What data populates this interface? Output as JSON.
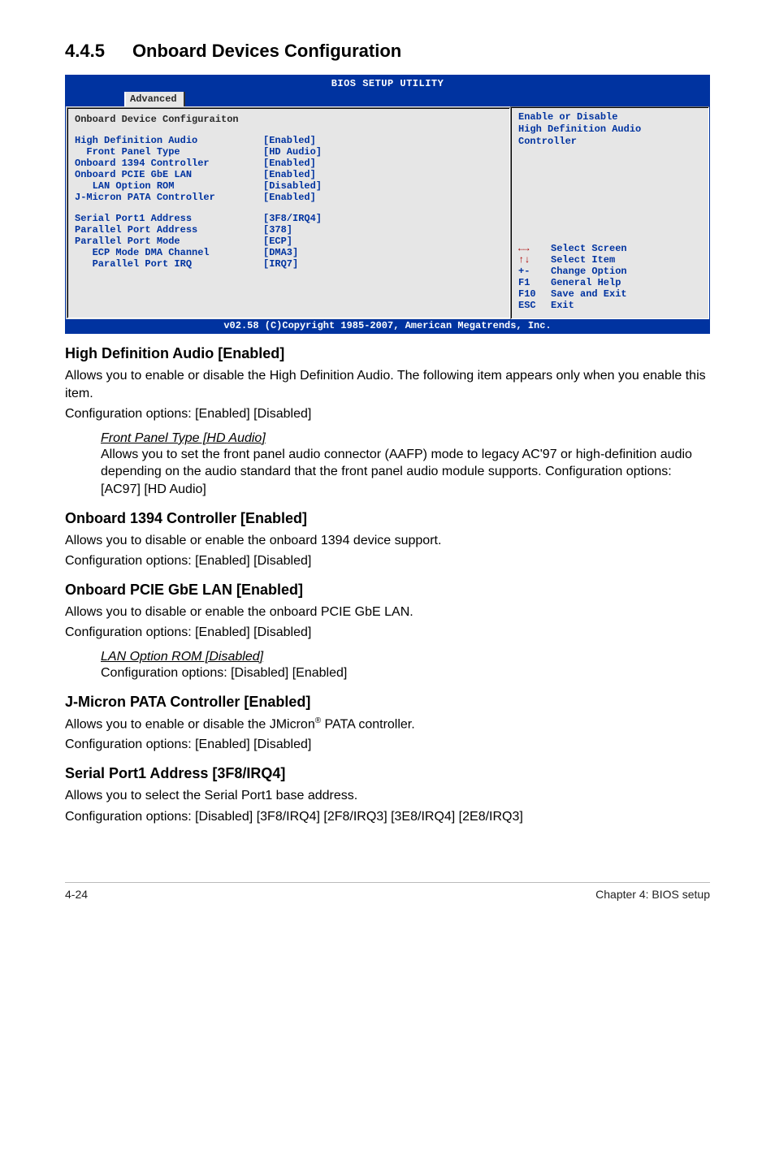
{
  "section": {
    "number": "4.4.5",
    "title": "Onboard Devices Configuration"
  },
  "bios": {
    "utility_title": "BIOS SETUP UTILITY",
    "tab": "Advanced",
    "panel_title": "Onboard Device Configuraiton",
    "rows": [
      {
        "label": "High Definition Audio",
        "value": "[Enabled]"
      },
      {
        "label": "  Front Panel Type",
        "value": "[HD Audio]"
      },
      {
        "label": "Onboard 1394 Controller",
        "value": "[Enabled]"
      },
      {
        "label": "Onboard PCIE GbE LAN",
        "value": "[Enabled]"
      },
      {
        "label": "   LAN Option ROM",
        "value": "[Disabled]"
      },
      {
        "label": "J-Micron PATA Controller",
        "value": "[Enabled]"
      }
    ],
    "rows2": [
      {
        "label": "Serial Port1 Address",
        "value": "[3F8/IRQ4]"
      },
      {
        "label": "Parallel Port Address",
        "value": "[378]"
      },
      {
        "label": "Parallel Port Mode",
        "value": "[ECP]"
      },
      {
        "label": "   ECP Mode DMA Channel",
        "value": "[DMA3]"
      },
      {
        "label": "   Parallel Port IRQ",
        "value": "[IRQ7]"
      }
    ],
    "help": {
      "l1": "Enable or Disable",
      "l2": "High Definition Audio",
      "l3": "Controller"
    },
    "nav": [
      {
        "key_html": "←→",
        "class": "arrow-lr",
        "text": "Select Screen"
      },
      {
        "key_html": "↑↓",
        "class": "arrow-ud",
        "text": "Select Item"
      },
      {
        "key_html": "+-",
        "class": "",
        "text": "Change Option"
      },
      {
        "key_html": "F1",
        "class": "",
        "text": "General Help"
      },
      {
        "key_html": "F10",
        "class": "",
        "text": "Save and Exit"
      },
      {
        "key_html": "ESC",
        "class": "",
        "text": "Exit"
      }
    ],
    "footer": "v02.58 (C)Copyright 1985-2007, American Megatrends, Inc."
  },
  "text": {
    "h_hd": "High Definition Audio [Enabled]",
    "p_hd1": "Allows you to enable or disable the High Definition Audio. The following item appears only when you enable this item.",
    "p_hd2": "Configuration options: [Enabled] [Disabled]",
    "fp_head": "Front Panel Type [HD Audio]",
    "fp_body": "Allows you to set the front panel audio connector (AAFP) mode to legacy AC'97 or high-definition audio depending on the audio standard that the front panel audio module supports. Configuration options: [AC97] [HD Audio]",
    "h_1394": "Onboard 1394 Controller [Enabled]",
    "p_1394a": "Allows you to disable or enable the onboard 1394 device support.",
    "p_1394b": "Configuration options: [Enabled] [Disabled]",
    "h_pcie": "Onboard PCIE GbE LAN [Enabled]",
    "p_pciea": "Allows you to disable or enable the onboard PCIE GbE LAN.",
    "p_pcieb": "Configuration options: [Enabled] [Disabled]",
    "lan_head": "LAN Option ROM [Disabled]",
    "lan_body": "Configuration options: [Disabled] [Enabled]",
    "h_jm": "J-Micron PATA Controller [Enabled]",
    "p_jm1_pre": "Allows you to enable or disable the JMicron",
    "p_jm1_suf": " PATA controller.",
    "p_jm2": "Configuration options: [Enabled] [Disabled]",
    "h_ser": "Serial Port1 Address [3F8/IRQ4]",
    "p_ser1": "Allows you to select the Serial Port1 base address.",
    "p_ser2": "Configuration options: [Disabled] [3F8/IRQ4] [2F8/IRQ3] [3E8/IRQ4] [2E8/IRQ3]"
  },
  "footer": {
    "left": "4-24",
    "right": "Chapter 4: BIOS setup"
  }
}
